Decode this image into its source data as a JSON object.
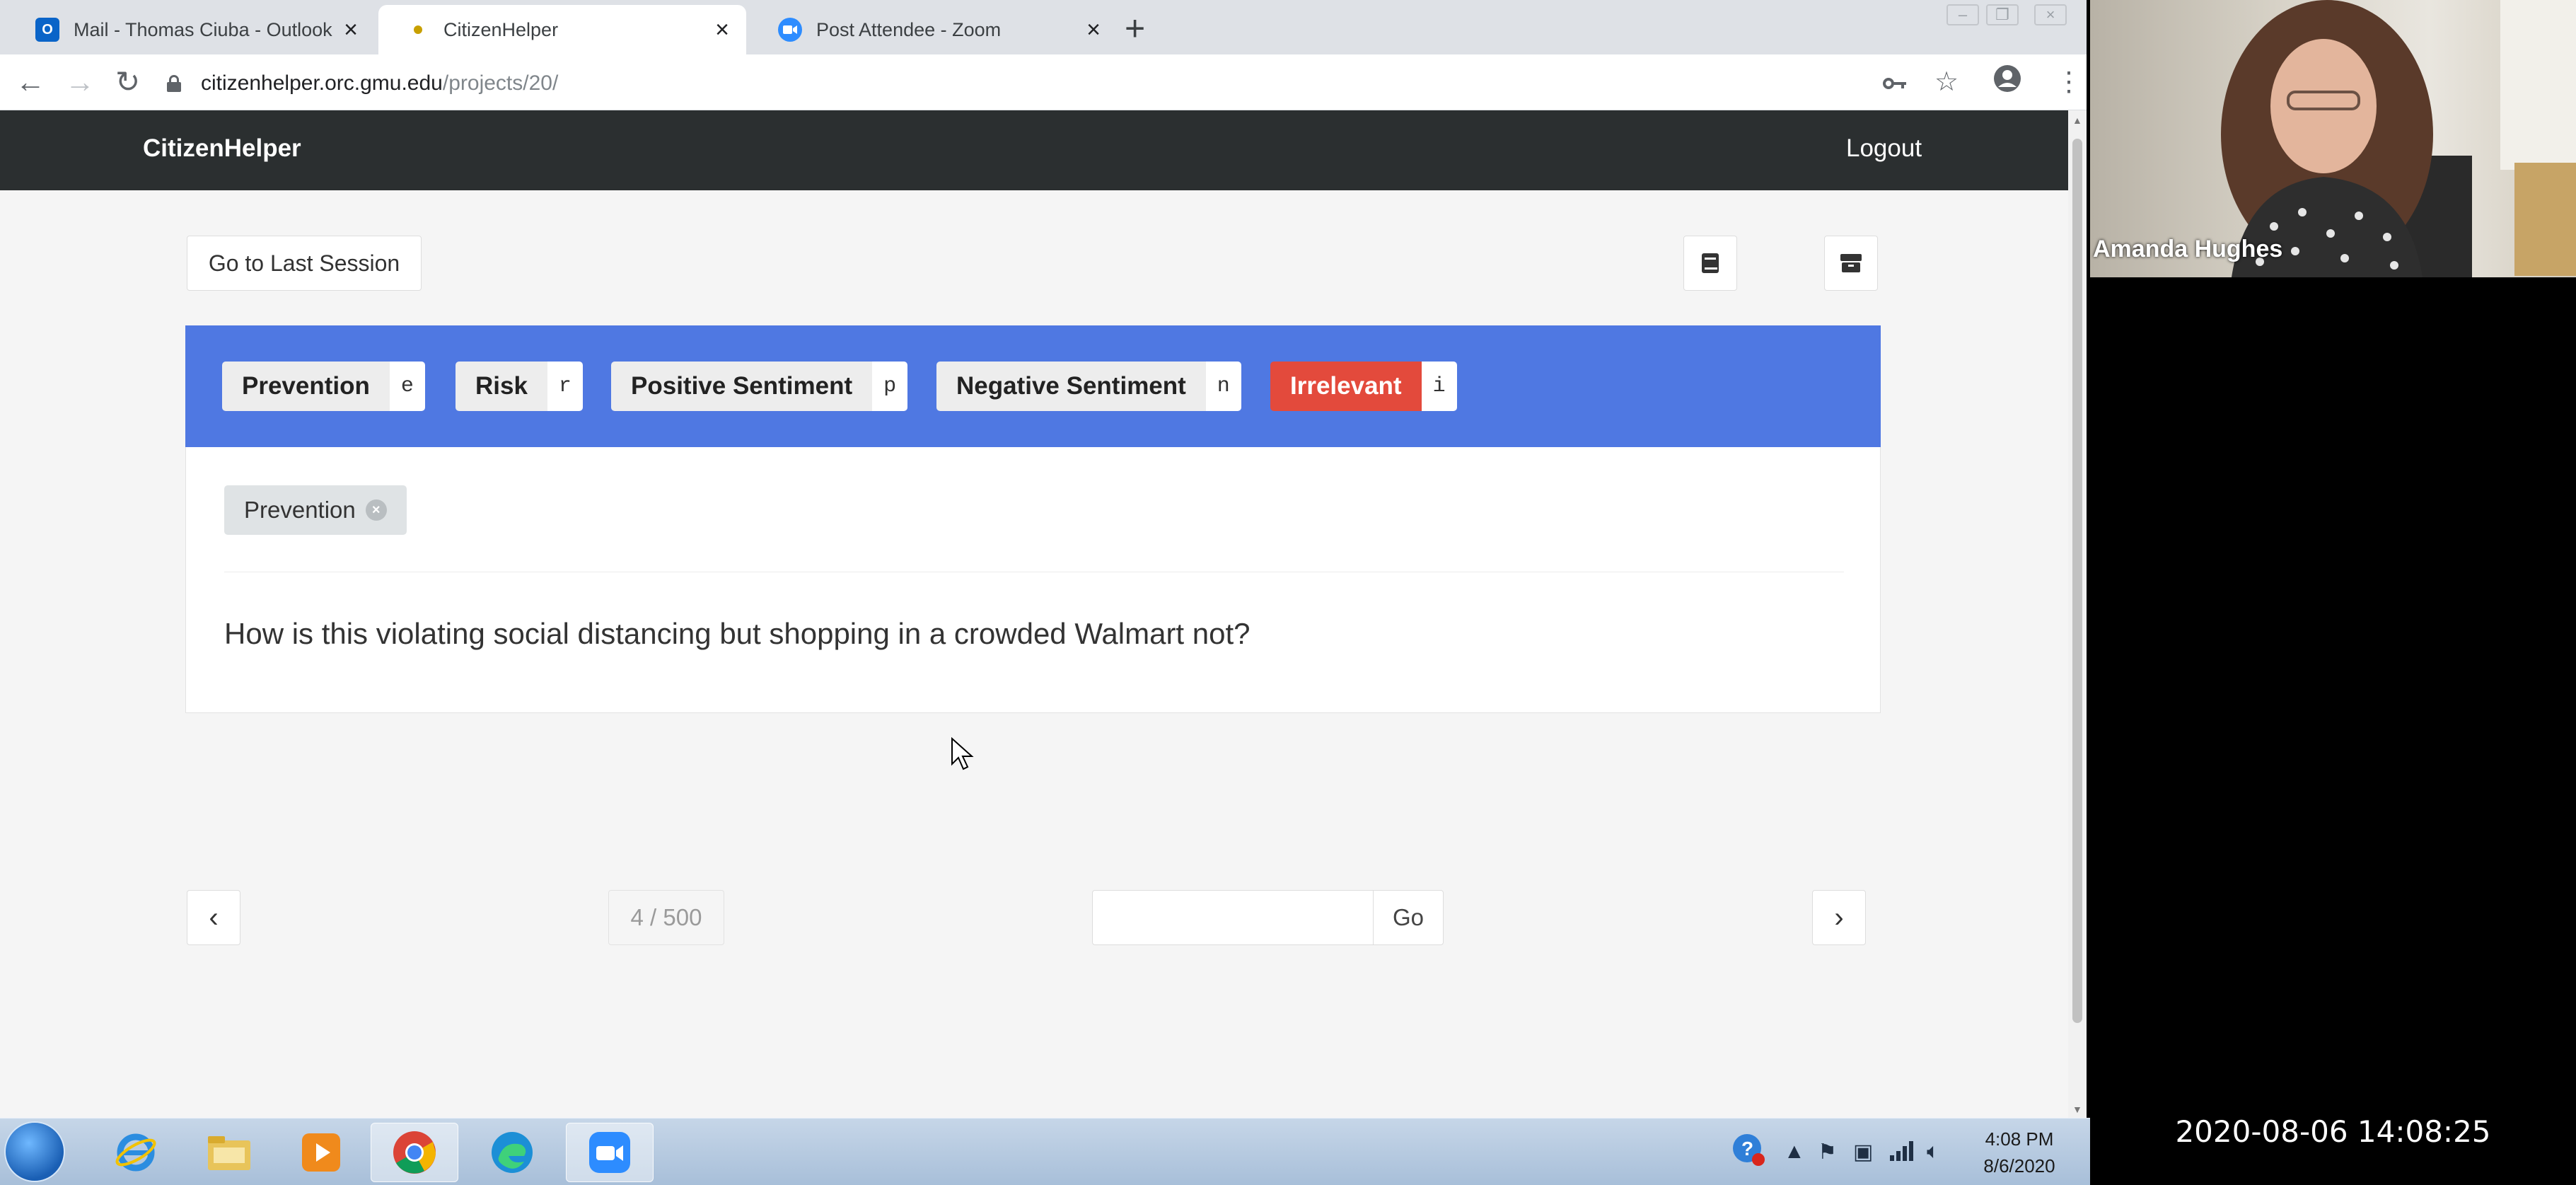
{
  "browser": {
    "tabs": [
      {
        "title": "Mail - Thomas Ciuba - Outlook",
        "icon": "outlook-icon",
        "active": false
      },
      {
        "title": "CitizenHelper",
        "icon": "page-favicon",
        "active": true
      },
      {
        "title": "Post Attendee - Zoom",
        "icon": "zoom-icon",
        "active": false
      }
    ],
    "new_tab_label": "+",
    "close_glyph": "×",
    "url_host": "citizenhelper.orc.gmu.edu",
    "url_path": "/projects/20/"
  },
  "app": {
    "brand": "CitizenHelper",
    "logout": "Logout",
    "last_session": "Go to Last Session",
    "labels": [
      {
        "name": "Prevention",
        "key": "e"
      },
      {
        "name": "Risk",
        "key": "r"
      },
      {
        "name": "Positive Sentiment",
        "key": "p"
      },
      {
        "name": "Negative Sentiment",
        "key": "n"
      },
      {
        "name": "Irrelevant",
        "key": "i"
      }
    ],
    "applied_tag": "Prevention",
    "tweet_text": "How is this violating social distancing but shopping in a crowded Walmart not?",
    "pager": {
      "counter": "4 / 500",
      "go_label": "Go",
      "prev_glyph": "‹",
      "next_glyph": "›",
      "current": 4,
      "total": 500
    }
  },
  "taskbar": {
    "apps": [
      "windows-start-icon",
      "internet-explorer-icon",
      "file-explorer-icon",
      "media-player-icon",
      "chrome-icon",
      "edge-icon",
      "zoom-icon"
    ],
    "clock_time": "4:08 PM",
    "clock_date": "8/6/2020"
  },
  "zoom": {
    "participant_name": "Amanda Hughes",
    "timestamp": "2020-08-06 14:08:25"
  },
  "colors": {
    "navbar": "#2b2f30",
    "label_bar": "#4f78e2",
    "irrelevant": "#e34a3c",
    "chip": "#dfe3e5"
  }
}
